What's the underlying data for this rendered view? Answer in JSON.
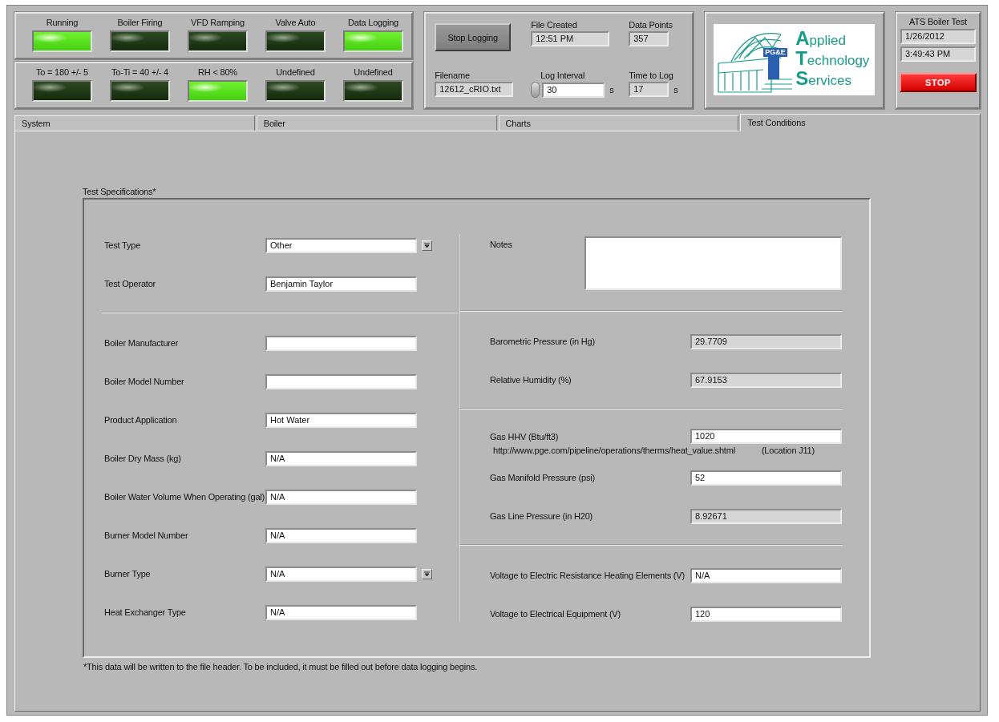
{
  "indicator_rows": [
    {
      "indicators": [
        {
          "label": "Running",
          "on": true
        },
        {
          "label": "Boiler Firing",
          "on": false
        },
        {
          "label": "VFD Ramping",
          "on": false
        },
        {
          "label": "Valve Auto",
          "on": false
        },
        {
          "label": "Data Logging",
          "on": true
        }
      ]
    },
    {
      "indicators": [
        {
          "label": "To = 180 +/- 5",
          "on": false
        },
        {
          "label": "To-Ti = 40 +/- 4",
          "on": false
        },
        {
          "label": "RH < 80%",
          "on": true
        },
        {
          "label": "Undefined",
          "on": false
        },
        {
          "label": "Undefined",
          "on": false
        }
      ]
    }
  ],
  "logging": {
    "button": "Stop Logging",
    "file_created": {
      "label": "File Created",
      "value": "12:51 PM"
    },
    "data_points": {
      "label": "Data Points",
      "value": "357"
    },
    "filename": {
      "label": "Filename",
      "value": "12612_cRIO.txt"
    },
    "log_interval": {
      "label": "Log Interval",
      "value": "30",
      "unit": "s"
    },
    "time_to_log": {
      "label": "Time to Log",
      "value": "17",
      "unit": "s"
    }
  },
  "logo": {
    "badge": "PG&E",
    "lines": [
      "Applied",
      "Technology",
      "Services"
    ]
  },
  "ats": {
    "title": "ATS Boiler Test",
    "date": "1/26/2012",
    "time": "3:49:43 PM",
    "stop_button": "STOP"
  },
  "tabs": [
    {
      "label": "System",
      "selected": false
    },
    {
      "label": "Boiler",
      "selected": false
    },
    {
      "label": "Charts",
      "selected": false
    },
    {
      "label": "Test Conditions",
      "selected": true
    }
  ],
  "test_specifications": {
    "title": "Test Specifications*",
    "left_sections": [
      {
        "fields": [
          {
            "kind": "dropdown",
            "label": "Test Type",
            "value": "Other"
          },
          {
            "kind": "text",
            "label": "Test Operator",
            "value": "Benjamin Taylor"
          }
        ]
      },
      {
        "fields": [
          {
            "kind": "text",
            "label": "Boiler Manufacturer"
          },
          {
            "kind": "text",
            "label": "Boiler Model Number"
          },
          {
            "kind": "text",
            "label": "Product Application",
            "value": "Hot Water"
          },
          {
            "kind": "text",
            "label": "Boiler Dry Mass (kg)",
            "value": "N/A"
          },
          {
            "kind": "text",
            "label": "Boiler Water Volume When Operating (gal)",
            "value": "N/A"
          },
          {
            "kind": "text",
            "label": "Burner Model Number",
            "value": "N/A"
          },
          {
            "kind": "dropdown",
            "label": "Burner Type",
            "value": "N/A"
          },
          {
            "kind": "text",
            "label": "Heat Exchanger Type",
            "value": "N/A"
          }
        ]
      }
    ],
    "right_sections": [
      {
        "fields": [
          {
            "kind": "notes",
            "label": "Notes"
          }
        ]
      },
      {
        "fields": [
          {
            "kind": "indicator",
            "label": "Barometric Pressure (in Hg)",
            "value": "29.7709"
          },
          {
            "kind": "indicator",
            "label": "Relative Humidity (%)",
            "value": "67.9153"
          }
        ]
      },
      {
        "fields": [
          {
            "kind": "text",
            "label": "Gas HHV (Btu/ft3)",
            "value": "1020",
            "url": "http://www.pge.com/pipeline/operations/therms/heat_value.shtml",
            "note": "(Location J11)"
          },
          {
            "kind": "text",
            "label": "Gas Manifold Pressure (psi)",
            "value": "52"
          },
          {
            "kind": "indicator",
            "label": "Gas Line Pressure (in H20)",
            "value": "8.92671"
          }
        ]
      },
      {
        "fields": [
          {
            "kind": "text",
            "label": "Voltage to Electric Resistance Heating Elements (V)",
            "value": "N/A"
          },
          {
            "kind": "text",
            "label": "Voltage to Electrical Equipment (V)",
            "value": "120"
          }
        ]
      }
    ],
    "footnote": "*This data will be written to the file header. To be included, it must be filled out before data logging begins."
  }
}
